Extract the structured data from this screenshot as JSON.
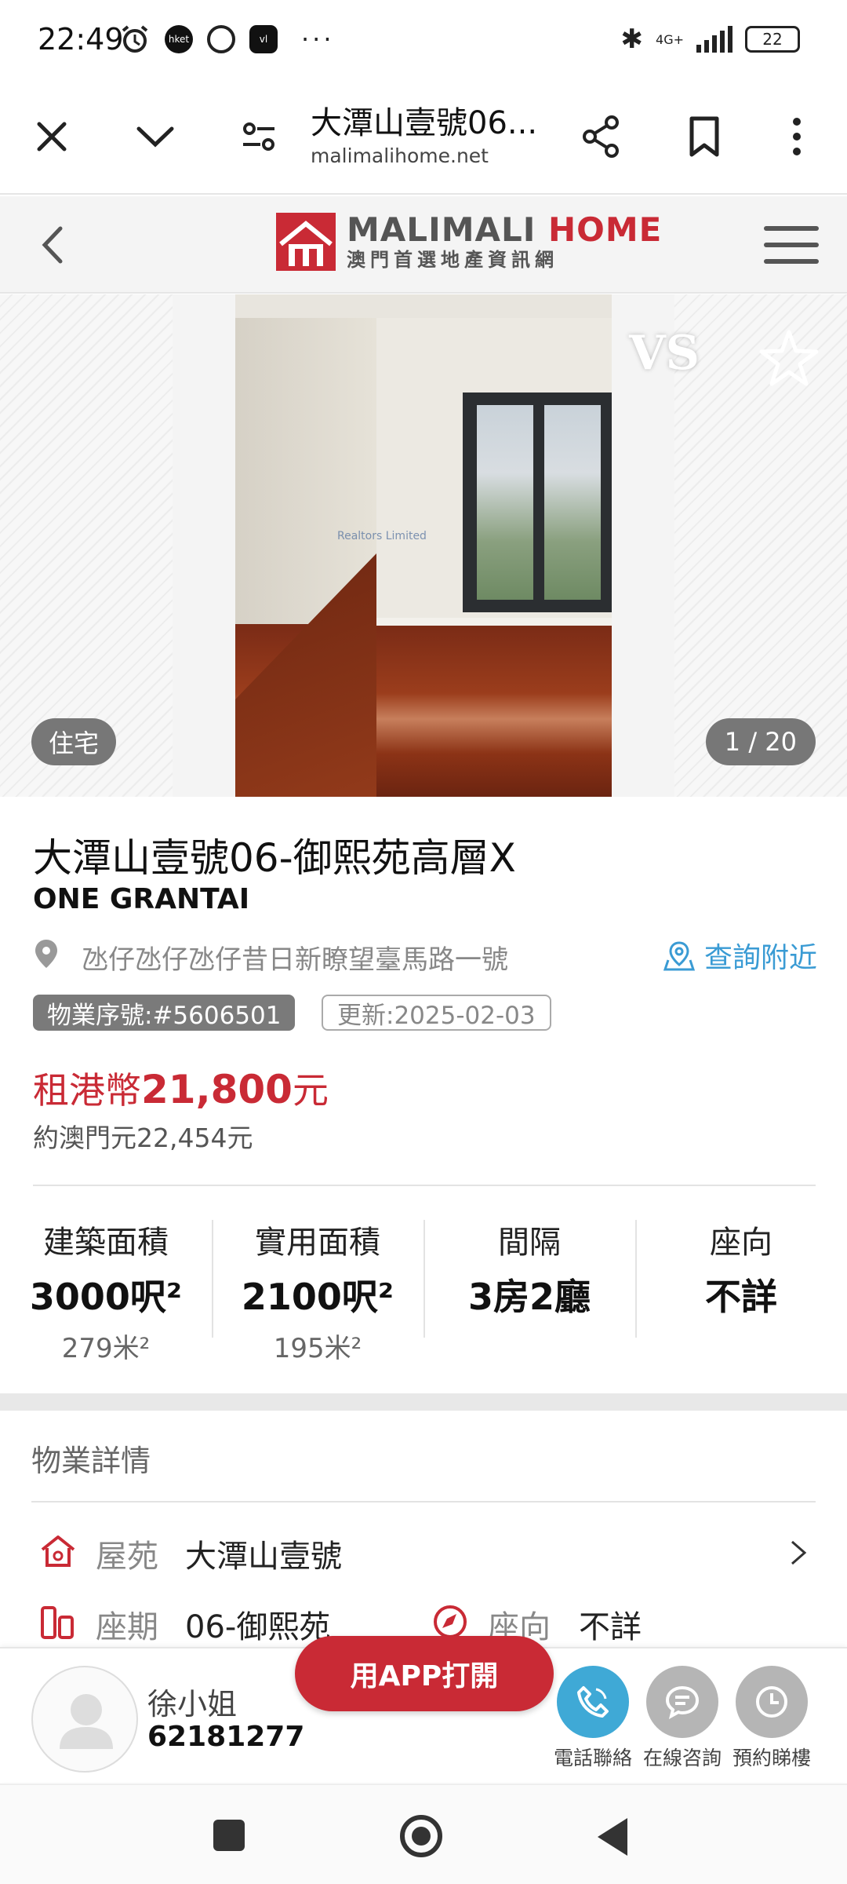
{
  "status_bar": {
    "time": "22:49",
    "notif_icons": [
      "alarm-icon",
      "hket-icon",
      "chrome-icon",
      "app-icon"
    ],
    "chip1": "hket",
    "chip2": "vl",
    "more": "···",
    "network": "4G+",
    "battery": "22"
  },
  "browser": {
    "title": "大潭山壹號06...",
    "url": "malimalihome.net"
  },
  "site": {
    "logo_en_gray": "MALIMALI ",
    "logo_en_red": "HOME",
    "logo_cn": "澳門首選地產資訊網"
  },
  "gallery": {
    "vs_label": "VS",
    "type_tag": "住宅",
    "counter": "1 / 20",
    "watermark": "Realtors Limited"
  },
  "listing": {
    "title_cn": "大潭山壹號06-御熙苑高層X",
    "title_en": "ONE GRANTAI",
    "address": "氹仔氹仔氹仔昔日新瞭望臺馬路一號",
    "nearby_label": "查詢附近",
    "property_id": "物業序號:#5606501",
    "updated": "更新:2025-02-03",
    "price_prefix": "租港幣",
    "price_amount": "21,800",
    "price_suffix": "元",
    "price_alt": "約澳門元22,454元"
  },
  "stats": [
    {
      "label": "建築面積",
      "value": "3000呎²",
      "sub": "279米²"
    },
    {
      "label": "實用面積",
      "value": "2100呎²",
      "sub": "195米²"
    },
    {
      "label": "間隔",
      "value": "3房2廳",
      "sub": ""
    },
    {
      "label": "座向",
      "value": "不詳",
      "sub": ""
    }
  ],
  "details": {
    "section_title": "物業詳情",
    "estate_label": "屋苑",
    "estate_value": "大潭山壹號",
    "phase_label": "座期",
    "phase_value": "06-御熙苑",
    "orientation_label": "座向",
    "orientation_value": "不詳"
  },
  "contact": {
    "agent_name": "徐小姐",
    "agent_phone": "62181277",
    "open_app": "用APP打開",
    "call_label": "電話聯絡",
    "chat_label": "在線咨詢",
    "book_label": "預約睇樓"
  },
  "colors": {
    "brand_red": "#c92a35",
    "link_blue": "#3a9bd4",
    "call_blue": "#3fa9d6",
    "gray_button": "#b5b5b5"
  }
}
